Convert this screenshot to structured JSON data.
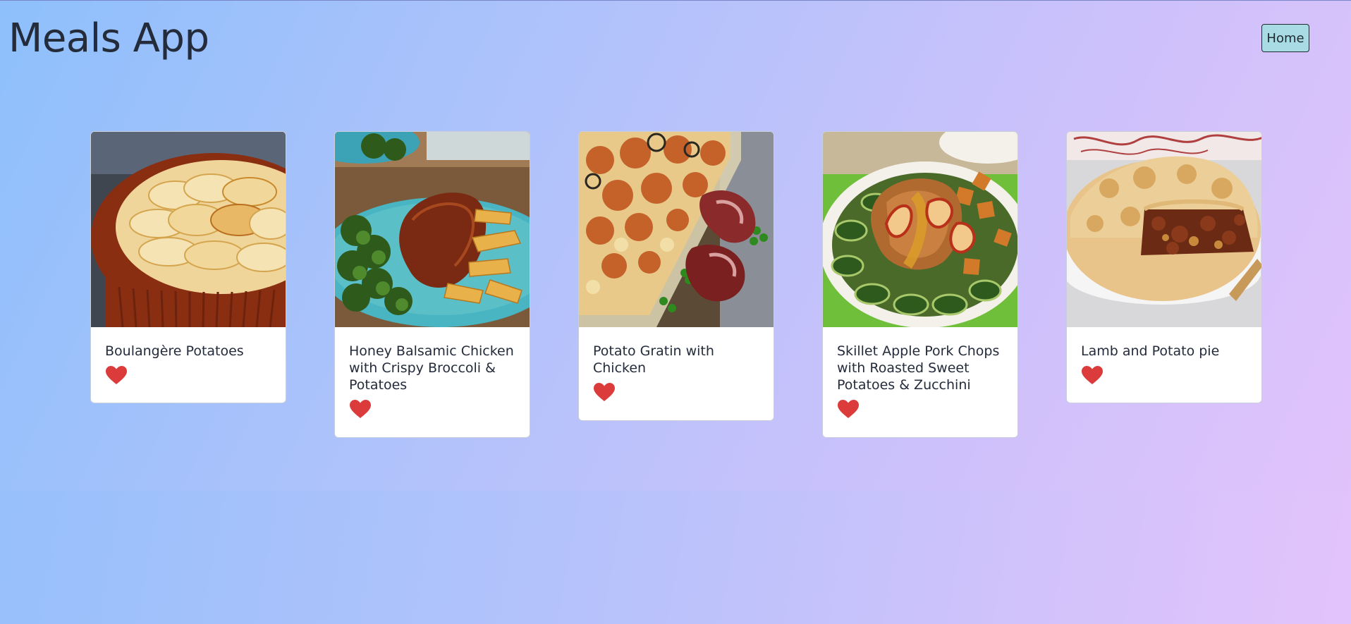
{
  "app": {
    "title": "Meals App",
    "home_label": "Home"
  },
  "meals": [
    {
      "name": "Boulangère Potatoes",
      "favorite": true,
      "image": "sliced potatoes baked in a brown dish"
    },
    {
      "name": "Honey Balsamic Chicken with Crispy Broccoli & Potatoes",
      "favorite": true,
      "image": "glazed chicken breast with broccoli and potato wedges"
    },
    {
      "name": "Potato Gratin with Chicken",
      "favorite": true,
      "image": "potato gratin in glass dish with chicken and peas"
    },
    {
      "name": "Skillet Apple Pork Chops with Roasted Sweet Potatoes & Zucchini",
      "favorite": true,
      "image": "pork chop with apples, sweet potato and zucchini"
    },
    {
      "name": "Lamb and Potato pie",
      "favorite": true,
      "image": "pastry pie with lamb filling"
    }
  ],
  "colors": {
    "heart": "#db3b3b",
    "home_button_bg": "#a9dbe5",
    "title_text": "#242b3a"
  },
  "icons": {
    "favorite": "heart-icon"
  }
}
